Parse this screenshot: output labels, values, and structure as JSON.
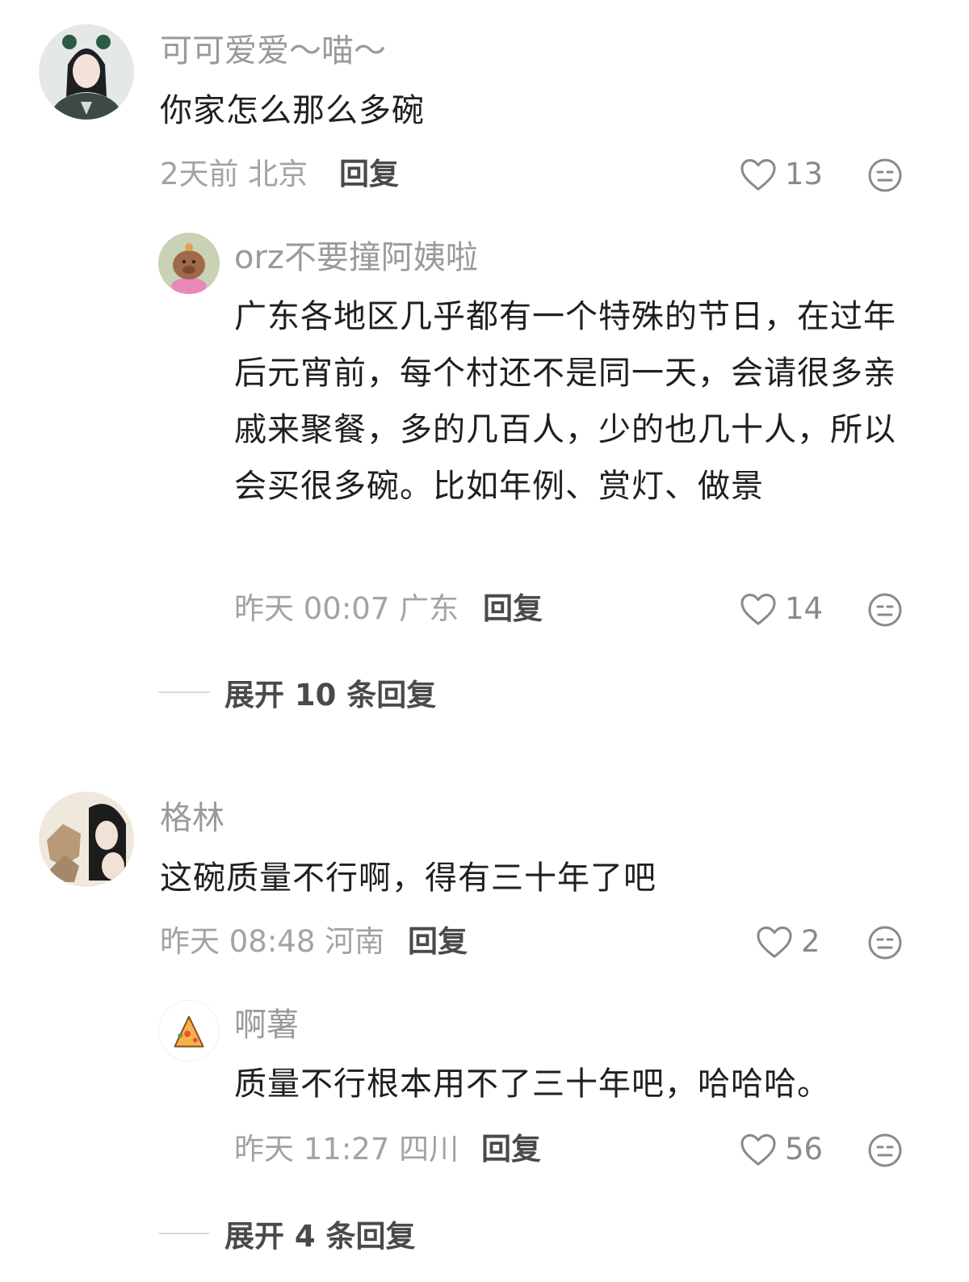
{
  "comments": [
    {
      "username": "可可爱爱～喵～",
      "text": "你家怎么那么多碗",
      "meta": "2天前 北京",
      "reply_label": "回复",
      "likes": "13",
      "replies": [
        {
          "username": "orz不要撞阿姨啦",
          "text": "广东各地区几乎都有一个特殊的节日，在过年后元宵前，每个村还不是同一天，会请很多亲戚来聚餐，多的几百人，少的也几十人，所以会买很多碗。比如年例、赏灯、做景",
          "meta": "昨天 00:07 广东",
          "reply_label": "回复",
          "likes": "14"
        }
      ],
      "expand_label": "展开 10 条回复"
    },
    {
      "username": "格林",
      "text": "这碗质量不行啊，得有三十年了吧",
      "meta": "昨天 08:48 河南",
      "reply_label": "回复",
      "likes": "2",
      "replies": [
        {
          "username": "啊薯",
          "text": "质量不行根本用不了三十年吧，哈哈哈。",
          "meta": "昨天 11:27 四川",
          "reply_label": "回复",
          "likes": "56"
        }
      ],
      "expand_label": "展开 4 条回复"
    }
  ],
  "icons": {
    "like": "heart-outline-icon",
    "dislike": "neutral-face-icon"
  },
  "colors": {
    "text_primary": "#1f1f1f",
    "text_muted": "#a3a3a3",
    "action": "#4a4a4a"
  }
}
